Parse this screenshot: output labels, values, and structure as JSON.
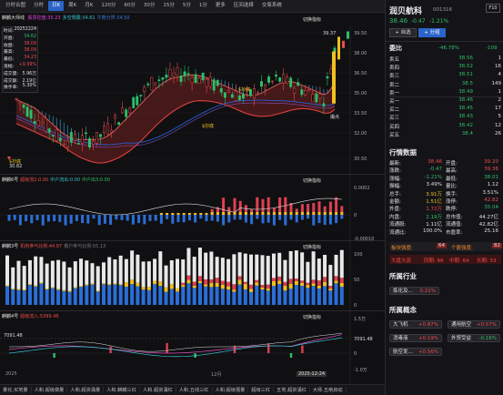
{
  "toolbar": {
    "items": [
      "分时合图",
      "分时",
      "日K",
      "周K",
      "月K",
      "120分",
      "60分",
      "30分",
      "15分",
      "5分",
      "1分",
      "更多",
      "区间选择",
      "交易系统"
    ],
    "active_index": 2
  },
  "main_panel": {
    "legend_label": "麒麟大师线",
    "legend_items": [
      {
        "text": "股票控盘:35.23",
        "color": "#e040e0"
      },
      {
        "text": "多空慢跟:34.61",
        "color": "#36c0d0"
      },
      {
        "text": "牛熊分界:34.50",
        "color": "#3a7ad8"
      }
    ],
    "switch_label": "切换指标",
    "info_box": {
      "rows": [
        [
          "时间:",
          "20251224"
        ],
        [
          "开盘:",
          "34.62"
        ],
        [
          "收盘:",
          "38.09"
        ],
        [
          "最高:",
          "38.09"
        ],
        [
          "最低:",
          "34.23"
        ],
        [
          "涨幅:",
          "+9.99%"
        ],
        [
          "成交量:",
          "5.96万"
        ],
        [
          "成交额:",
          "2.19亿"
        ],
        [
          "换手率:",
          "5.30%"
        ]
      ]
    },
    "price_axis": [
      "39.50",
      "38.00",
      "36.50",
      "35.00",
      "33.50",
      "32.00",
      "30.50"
    ],
    "annotations": {
      "high_price": "39.37",
      "low_price": "30.82",
      "buy1": "$抄底",
      "buy2": "$抄底",
      "buy3": "$抄底",
      "sell": "撮点"
    }
  },
  "panel2": {
    "title": "麒麟6号",
    "items": [
      {
        "text": "超级流2:0.00",
        "color": "#ef4a4a"
      },
      {
        "text": "中户流出:0.00",
        "color": "#36c0d0"
      },
      {
        "text": "中户出3:0.00",
        "color": "#2fbf6a"
      }
    ],
    "switch_label": "切换指标",
    "axis": [
      "0.0002",
      "0",
      "-0.00010"
    ]
  },
  "panel3": {
    "title": "麒麟3号",
    "items": [
      {
        "text": "机构参与比例:44.87",
        "color": "#ef4a4a"
      },
      {
        "text": "散户参与比例:55.13",
        "color": "#777777"
      }
    ],
    "switch_label": "切换指标",
    "axis": [
      "100",
      "50",
      "0"
    ]
  },
  "panel4": {
    "title": "麒麟4号",
    "items": [
      {
        "text": "超级流入:5399.46",
        "color": "#ef4a4a"
      }
    ],
    "switch_label": "切换指标",
    "left_value": "7091.48",
    "right_value": "7091.48",
    "axis": [
      "1.5万",
      "0",
      "-1.0万"
    ]
  },
  "date_axis": {
    "start": "2025",
    "mid": "12月",
    "end": "2025-12-24"
  },
  "bottom_tabs": [
    "量化.买地量",
    "人和.超级做量",
    "人和.超资涌量",
    "人和.麒麟三红",
    "人和.超资涌红",
    "人和.五线三红",
    "人和.超级强量",
    "超级三红",
    "五地.超资涌红",
    "大师.五绝启动"
  ],
  "stock": {
    "name": "润贝航科",
    "code": "001316",
    "btn": "F10",
    "price": "38.46",
    "change": "-0.47",
    "pct": "-1.21%",
    "self_select": "+ 自选",
    "group": "+ 分组"
  },
  "order_book": {
    "ratio_label": "委比",
    "ratio": "-46.78%",
    "diff": "-109",
    "asks": [
      [
        "卖五",
        "38.56",
        "1"
      ],
      [
        "卖四",
        "38.52",
        "16"
      ],
      [
        "卖三",
        "38.51",
        "4"
      ],
      [
        "卖二",
        "38.5",
        "149"
      ],
      [
        "卖一",
        "38.49",
        "1"
      ]
    ],
    "bids": [
      [
        "买一",
        "38.46",
        "2"
      ],
      [
        "买二",
        "38.45",
        "17"
      ],
      [
        "买三",
        "38.43",
        "5"
      ],
      [
        "买四",
        "38.42",
        "12"
      ],
      [
        "买五",
        "38.4",
        "26"
      ]
    ]
  },
  "quote": {
    "title": "行情数据",
    "rows": [
      [
        [
          "最新:",
          "38.46",
          "red"
        ],
        [
          "开盘:",
          "39.20",
          "red"
        ]
      ],
      [
        [
          "涨跌:",
          "-0.47",
          "grn"
        ],
        [
          "最高:",
          "39.36",
          "red"
        ]
      ],
      [
        [
          "涨幅:",
          "-1.21%",
          "grn"
        ],
        [
          "最低:",
          "38.01",
          "grn"
        ]
      ],
      [
        [
          "振幅:",
          "3.49%",
          "wh"
        ],
        [
          "量比:",
          "1.12",
          "wh"
        ]
      ],
      [
        [
          "总手:",
          "3.91万",
          "yel"
        ],
        [
          "换手:",
          "3.51%",
          "wh"
        ]
      ],
      [
        [
          "金额:",
          "1.51亿",
          "yel"
        ],
        [
          "涨停:",
          "42.82",
          "red"
        ]
      ],
      [
        [
          "外盘:",
          "1.72万",
          "red"
        ],
        [
          "跌停:",
          "35.04",
          "grn"
        ]
      ],
      [
        [
          "内盘:",
          "2.19万",
          "grn"
        ],
        [
          "总市值:",
          "44.27亿",
          "wh"
        ]
      ],
      [
        [
          "流通股:",
          "1.11亿",
          "wh"
        ],
        [
          "流通值:",
          "42.82亿",
          "wh"
        ]
      ],
      [
        [
          "流通比:",
          "100.0%",
          "wh"
        ],
        [
          "市盈率:",
          "25.16",
          "wh"
        ]
      ]
    ]
  },
  "strength": {
    "sector": "板块强度:",
    "sector_val": "64",
    "stock": "个股强度:",
    "stock_val": "82"
  },
  "capital": {
    "label": "大盘大资",
    "v1": "同期: 66",
    "v2": "中期: 64",
    "v3": "长期: 53"
  },
  "industry": {
    "title": "所属行业",
    "tag": "炼化及...",
    "val": "0.21%"
  },
  "concepts": {
    "title": "所属概念",
    "items": [
      [
        "大飞机",
        "+0.87%"
      ],
      [
        "通用航空",
        "+0.57%"
      ],
      [
        "消毒液",
        "+0.19%"
      ],
      [
        "外贸受益",
        "-0.16%"
      ],
      [
        "航空发...",
        "+0.56%"
      ]
    ]
  }
}
